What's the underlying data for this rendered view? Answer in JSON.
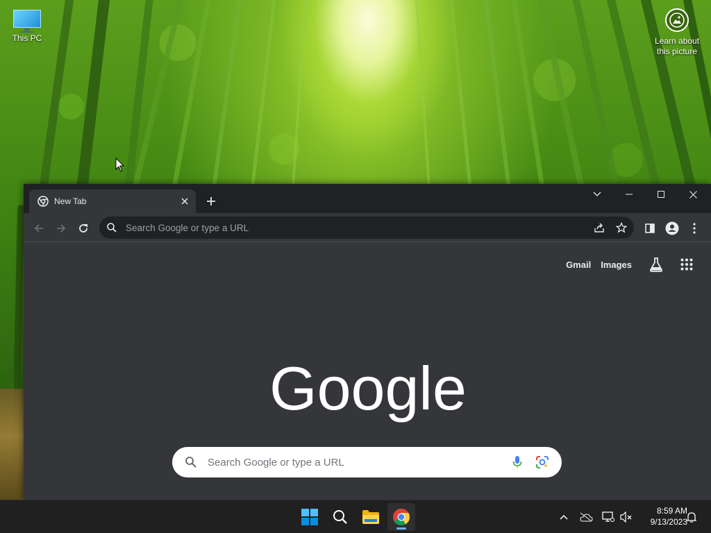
{
  "desktop": {
    "icons": [
      {
        "label": "This PC"
      }
    ],
    "spotlight": {
      "label": "Learn about this picture"
    }
  },
  "browser": {
    "tab": {
      "title": "New Tab"
    },
    "omnibox": {
      "placeholder": "Search Google or type a URL"
    },
    "ntp": {
      "links": {
        "gmail": "Gmail",
        "images": "Images"
      },
      "logo_text": "Google",
      "search_placeholder": "Search Google or type a URL"
    },
    "theme": "dark"
  },
  "taskbar": {
    "pinned": [
      "start-icon",
      "search-icon",
      "file-explorer-icon",
      "chrome-icon"
    ],
    "clock": {
      "time": "8:59 AM",
      "date": "9/13/2023"
    }
  },
  "colors": {
    "google_blue": "#4285f4",
    "google_red": "#ea4335",
    "google_yellow": "#fbbc05",
    "google_green": "#34a853",
    "chrome_dark_bg": "#35363a",
    "chrome_titlebar": "#202124",
    "taskbar": "#202020"
  }
}
